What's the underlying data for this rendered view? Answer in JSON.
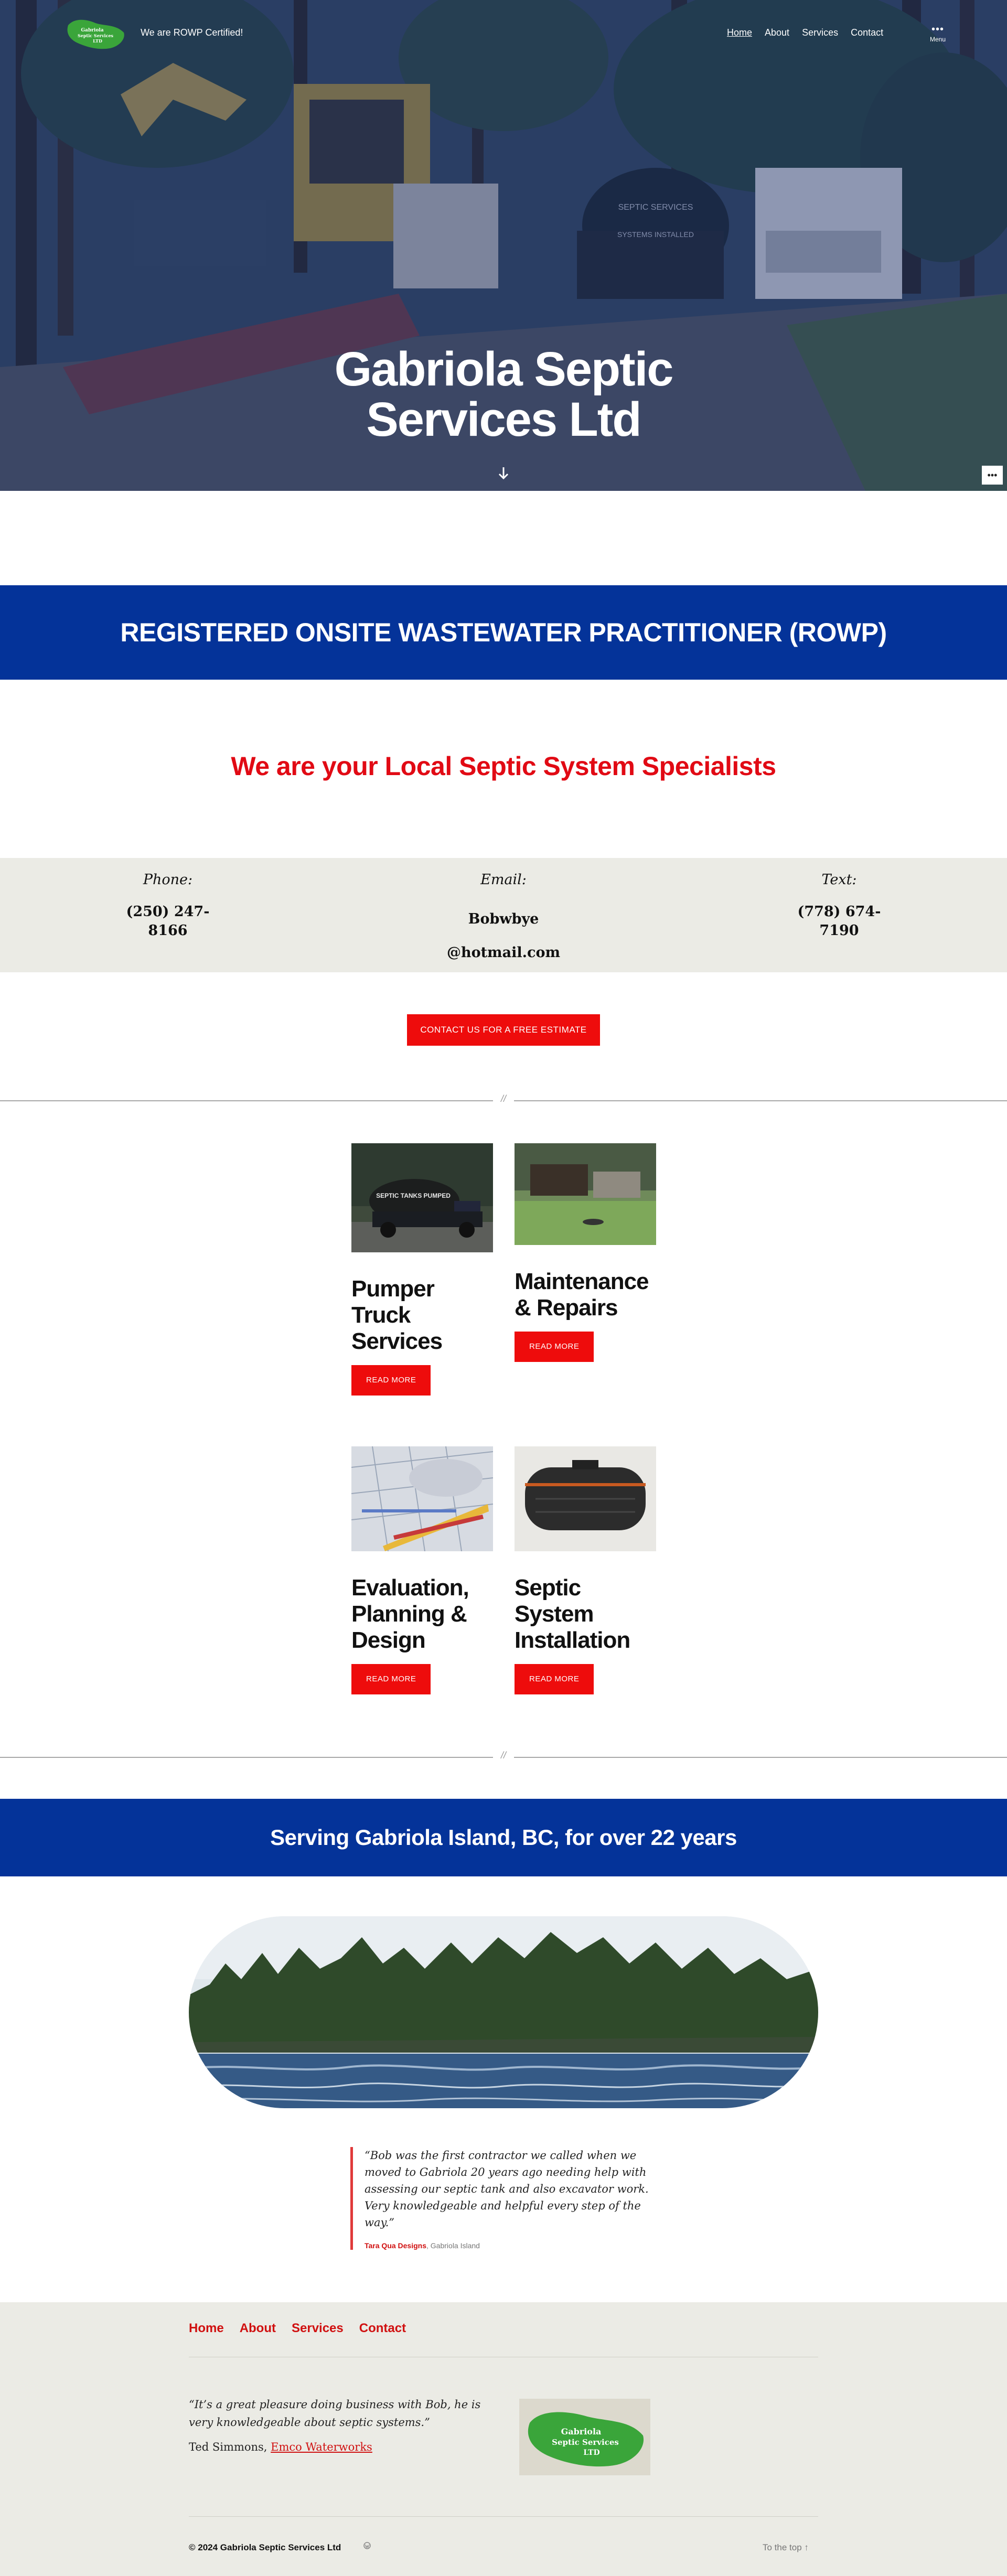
{
  "header": {
    "logo_text": [
      "Gabriola",
      "Septic Services",
      "LTD"
    ],
    "tagline": "We are ROWP Certified!",
    "nav": [
      "Home",
      "About",
      "Services",
      "Contact"
    ],
    "menu_label": "Menu",
    "more_icon": "ellipsis-icon"
  },
  "hero": {
    "title": "Gabriola Septic Services Ltd",
    "scroll_icon": "arrow-down-icon",
    "truck_tank_text": [
      "SEPTIC SERVICES",
      "SYSTEMS INSTALLED"
    ]
  },
  "rowp_banner": "REGISTERED ONSITE WASTEWATER PRACTITIONER (ROWP)",
  "specialists_heading": "We are your Local Septic System Specialists",
  "contact": {
    "phone_label": "Phone:",
    "phone_value": "(250) 247-8166",
    "email_label": "Email:",
    "email_line1": "Bobwbye",
    "email_line2": "@hotmail.com",
    "text_label": "Text:",
    "text_value": "(778) 674-7190"
  },
  "cta_label": "CONTACT US FOR A FREE ESTIMATE",
  "separator_mark": "//",
  "services": [
    {
      "title": "Pumper Truck Services",
      "button": "READ MORE",
      "image_text": "SEPTIC TANKS PUMPED"
    },
    {
      "title": "Maintenance & Repairs",
      "button": "READ MORE"
    },
    {
      "title": "Evaluation, Planning & Design",
      "button": "READ MORE"
    },
    {
      "title": "Septic System Installation",
      "button": "READ MORE"
    }
  ],
  "serving_banner": "Serving Gabriola Island, BC, for over 22 years",
  "testimonial": {
    "quote": "“Bob was the first contractor we called when we moved to Gabriola 20 years ago needing help with assessing our septic tank and also excavator work. Very knowledgeable and helpful every step of the way.”",
    "author": "Tara Qua Designs",
    "location": ", Gabriola Island"
  },
  "footer": {
    "nav": [
      "Home",
      "About",
      "Services",
      "Contact"
    ],
    "quote": "“It’s a great pleasure doing business with Bob, he is very knowledgeable about septic systems.”",
    "person": "Ted Simmons, ",
    "company": "Emco Waterworks",
    "logo_text": [
      "Gabriola",
      "Septic Services",
      "LTD"
    ],
    "copyright": "© 2024 Gabriola Septic Services Ltd",
    "to_top": "To the top ↑"
  },
  "colors": {
    "blue": "#043399",
    "red": "#ee0c0c",
    "logo_green": "#3aa53a",
    "footer_bg": "#ebebe5"
  }
}
